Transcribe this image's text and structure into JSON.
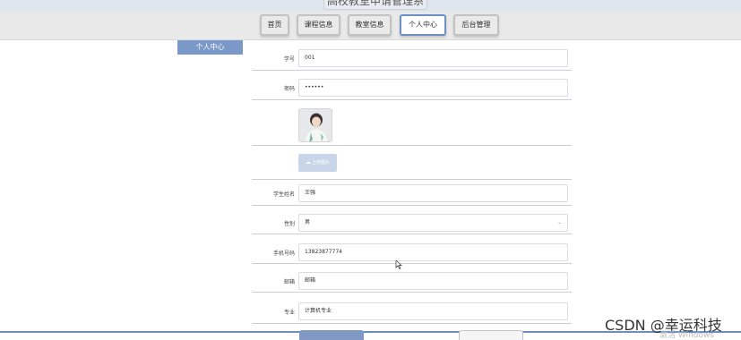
{
  "app": {
    "title": "高校教室申请管理系统"
  },
  "nav": {
    "items": [
      {
        "label": "首页",
        "active": false
      },
      {
        "label": "课程信息",
        "active": false
      },
      {
        "label": "教室信息",
        "active": false
      },
      {
        "label": "个人中心",
        "active": true
      },
      {
        "label": "后台管理",
        "active": false
      }
    ]
  },
  "sidebar": {
    "tab_label": "个人中心"
  },
  "form": {
    "student_id": {
      "label": "学号",
      "value": "001"
    },
    "password": {
      "label": "密码",
      "value": "••••••"
    },
    "upload": {
      "label": "上传图片",
      "icon": "cloud-upload-icon"
    },
    "name": {
      "label": "学生姓名",
      "value": "王强"
    },
    "gender": {
      "label": "性别",
      "value": "男"
    },
    "phone": {
      "label": "手机号码",
      "value": "13823877774"
    },
    "email": {
      "label": "邮箱",
      "value": "邮箱"
    },
    "major": {
      "label": "专业",
      "value": "计算机专业"
    }
  },
  "watermark": {
    "text": "CSDN @幸运科技",
    "windows": "激活 Windows"
  },
  "colors": {
    "accent": "#6e8fc4",
    "sidebar": "#7a98c8",
    "upload": "#c9d6ea"
  }
}
